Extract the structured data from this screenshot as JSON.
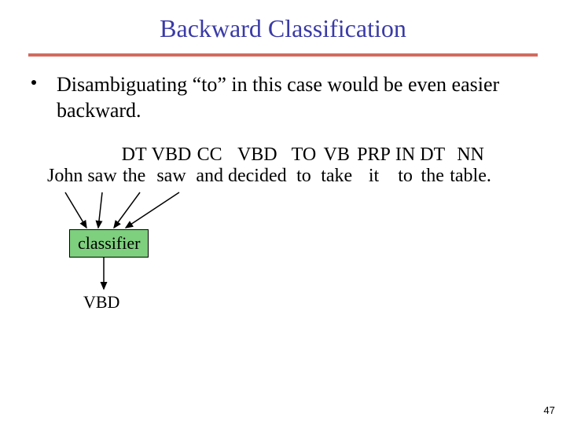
{
  "title": "Backward Classification",
  "bullet": "Disambiguating “to” in this case would be even easier backward.",
  "columns": [
    {
      "tag": "",
      "word": "John"
    },
    {
      "tag": "",
      "word": "saw"
    },
    {
      "tag": "DT",
      "word": "the"
    },
    {
      "tag": "VBD",
      "word": "saw"
    },
    {
      "tag": "CC",
      "word": "and"
    },
    {
      "tag": "VBD",
      "word": "decided"
    },
    {
      "tag": "TO",
      "word": "to"
    },
    {
      "tag": "VB",
      "word": "take"
    },
    {
      "tag": "PRP",
      "word": "it"
    },
    {
      "tag": "IN",
      "word": "to"
    },
    {
      "tag": "DT",
      "word": "the"
    },
    {
      "tag": "NN",
      "word": "table."
    }
  ],
  "classifier_label": "classifier",
  "output_tag": "VBD",
  "page_number": "47",
  "colors": {
    "title": "#3a3aa8",
    "rule": "#d36a5e",
    "classifier_bg": "#7ecf7e"
  }
}
